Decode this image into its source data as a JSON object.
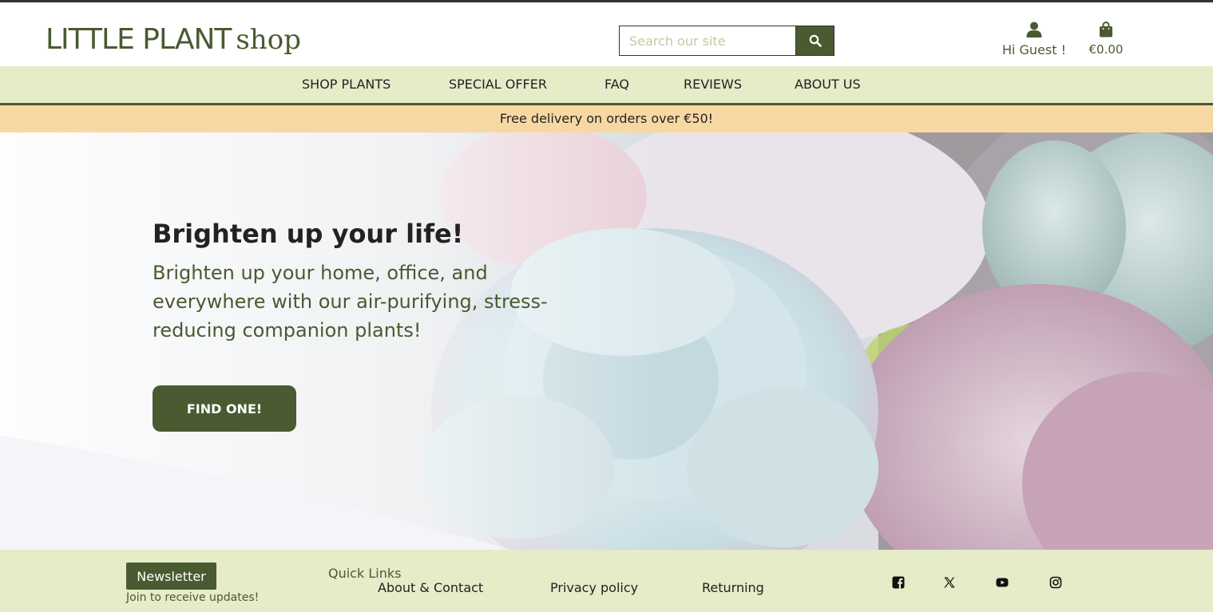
{
  "header": {
    "logo_main": "LITTLE PLANT",
    "logo_sub": "shop",
    "search_placeholder": "Search our site",
    "account_label": "Hi Guest !",
    "bag_total": "€0.00"
  },
  "nav": {
    "items": [
      {
        "label": "SHOP PLANTS"
      },
      {
        "label": "SPECIAL OFFER"
      },
      {
        "label": "FAQ"
      },
      {
        "label": "REVIEWS"
      },
      {
        "label": "ABOUT US"
      }
    ]
  },
  "promo": {
    "text": "Free delivery on orders over €50!"
  },
  "hero": {
    "title": "Brighten up your life!",
    "subtitle": "Brighten up your home, office, and everywhere with our air-purifying, stress-reducing companion plants!",
    "cta_label": "FIND ONE!"
  },
  "footer": {
    "newsletter_label": "Newsletter",
    "newsletter_note": "Join to receive updates!",
    "quick_links_title": "Quick Links",
    "links": [
      {
        "label": "About & Contact"
      },
      {
        "label": "Privacy policy"
      },
      {
        "label": "Returning"
      }
    ],
    "social_icons": [
      "facebook-icon",
      "x-icon",
      "youtube-icon",
      "instagram-icon"
    ]
  },
  "colors": {
    "brand_green": "#4a5a31",
    "nav_background": "#e6ebc8",
    "promo_background": "#f8d8a2"
  },
  "icons": {
    "search": "search-icon",
    "account": "user-icon",
    "bag": "shopping-bag-icon"
  }
}
